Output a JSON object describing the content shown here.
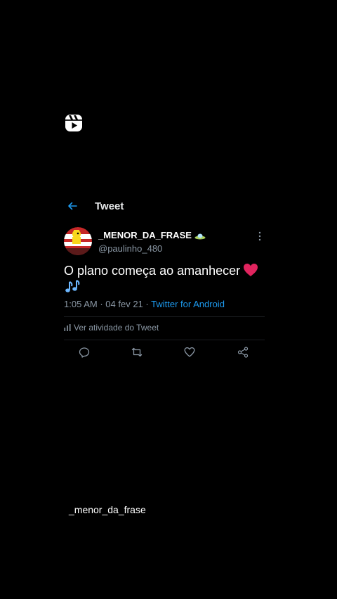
{
  "header": {
    "title": "Tweet"
  },
  "tweet": {
    "display_name": "_MENOR_DA_FRASE",
    "handle": "@paulinho_480",
    "text": "O plano começa ao amanhecer",
    "time": "1:05 AM",
    "separator": "·",
    "date": "04 fev 21",
    "source": "Twitter for Android",
    "activity_label": "Ver atividade do Tweet"
  },
  "caption": {
    "username": "_menor_da_frase"
  },
  "icons": {
    "top": "reels-icon",
    "back": "arrow-left-icon",
    "more": "more-vertical-icon",
    "activity": "bar-chart-icon",
    "reply": "reply-icon",
    "retweet": "retweet-icon",
    "like": "heart-outline-icon",
    "share": "share-icon"
  },
  "colors": {
    "background": "#000000",
    "accent": "#1d9bf0",
    "muted": "#8b98a5",
    "heart": "#e0245e"
  }
}
